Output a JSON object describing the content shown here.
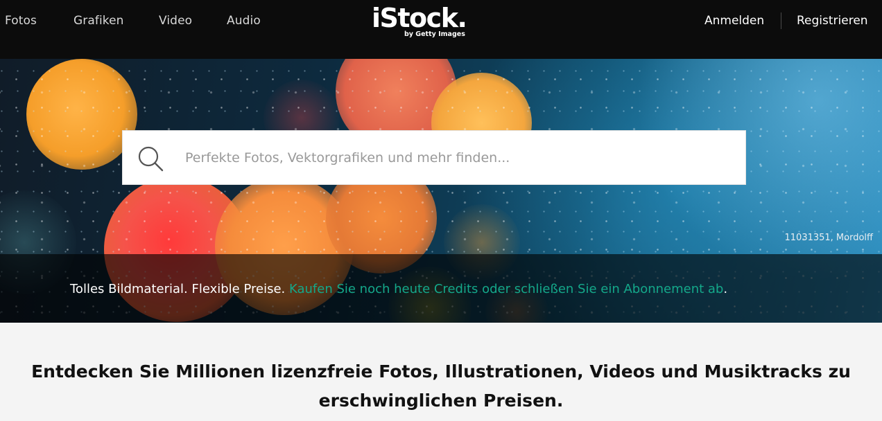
{
  "nav": {
    "links": [
      "Fotos",
      "Grafiken",
      "Video",
      "Audio"
    ],
    "login": "Anmelden",
    "register": "Registrieren"
  },
  "logo": {
    "main": "iStock.",
    "sub": "by Getty Images"
  },
  "search": {
    "placeholder": "Perfekte Fotos, Vektorgrafiken und mehr finden..."
  },
  "hero": {
    "credit": "11031351, Mordolff",
    "promo_text": "Tolles Bildmaterial. Flexible Preise. ",
    "promo_link": "Kaufen Sie noch heute Credits oder schließen Sie ein Abonnement ab",
    "promo_end": "."
  },
  "content": {
    "headline": "Entdecken Sie Millionen lizenzfreie Fotos, Illustrationen, Videos und Musiktracks zu erschwinglichen Preisen."
  },
  "colors": {
    "nav_bg": "#0c0c0c",
    "link_accent": "#14a88a",
    "page_bg": "#f4f4f4"
  }
}
